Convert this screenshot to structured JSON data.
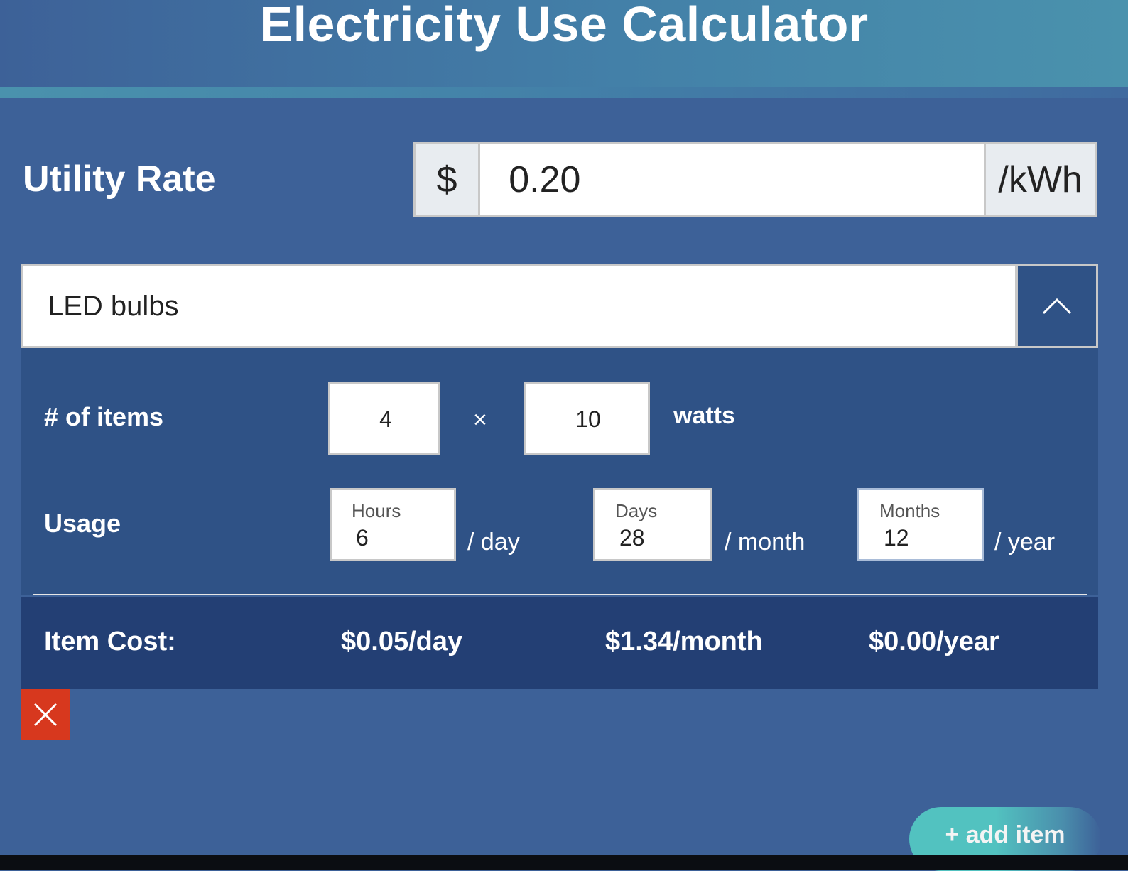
{
  "header": {
    "title": "Electricity Use Calculator"
  },
  "utility_rate": {
    "label": "Utility Rate",
    "prefix": "$",
    "value": "0.20",
    "suffix": "/kWh"
  },
  "item": {
    "name": "LED bulbs",
    "collapse_icon": "chevron-up-icon",
    "count_row": {
      "label": "# of items",
      "count": "4",
      "times_symbol": "×",
      "watts": "10",
      "watts_unit": "watts"
    },
    "usage_row": {
      "label": "Usage",
      "hours": {
        "label": "Hours",
        "value": "6",
        "unit": "/ day"
      },
      "days": {
        "label": "Days",
        "value": "28",
        "unit": "/ month"
      },
      "months": {
        "label": "Months",
        "value": "12",
        "unit": "/ year"
      }
    },
    "cost": {
      "label": "Item Cost:",
      "per_day": "$0.05/day",
      "per_month": "$1.34/month",
      "per_year": "$0.00/year"
    },
    "delete_icon": "close-icon"
  },
  "actions": {
    "add_item_label": "+ add item"
  },
  "colors": {
    "background": "#3d6198",
    "panel": "#2f5286",
    "cost_bar": "#233f74",
    "delete": "#d7381e",
    "accent": "#52c2c0"
  }
}
